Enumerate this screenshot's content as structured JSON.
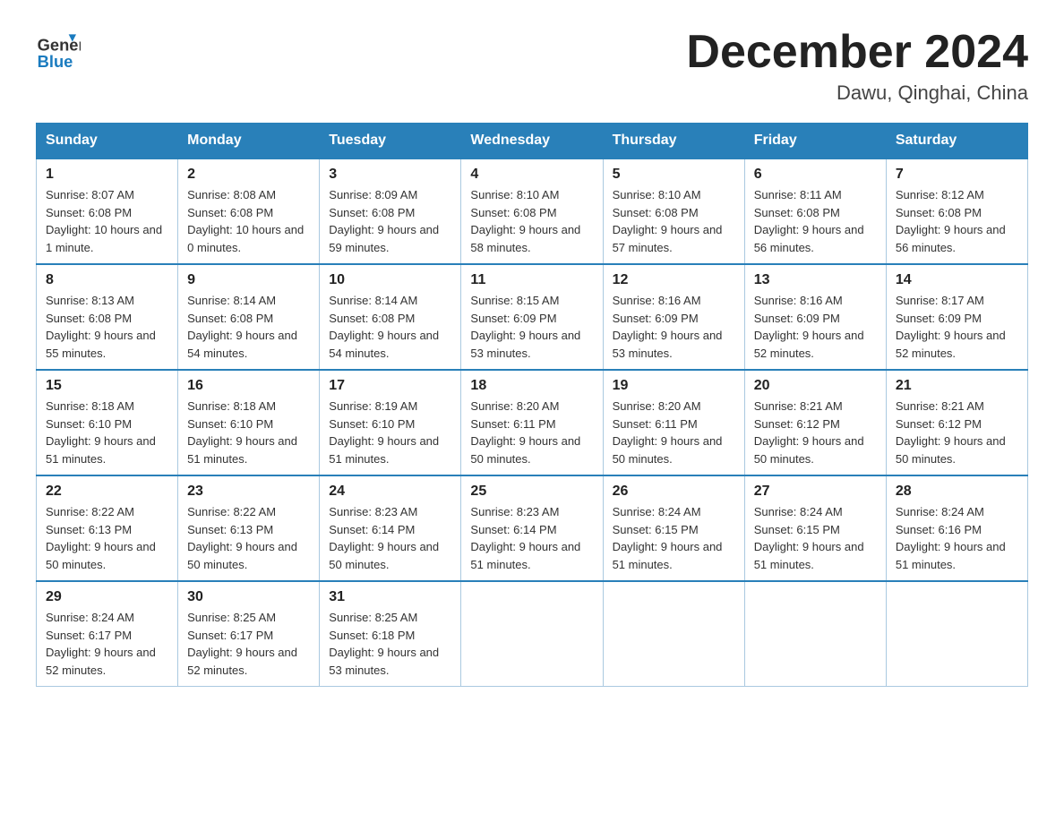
{
  "header": {
    "logo_general": "General",
    "logo_blue": "Blue",
    "title": "December 2024",
    "subtitle": "Dawu, Qinghai, China"
  },
  "calendar": {
    "days_of_week": [
      "Sunday",
      "Monday",
      "Tuesday",
      "Wednesday",
      "Thursday",
      "Friday",
      "Saturday"
    ],
    "weeks": [
      [
        {
          "day": "1",
          "sunrise": "8:07 AM",
          "sunset": "6:08 PM",
          "daylight": "10 hours and 1 minute."
        },
        {
          "day": "2",
          "sunrise": "8:08 AM",
          "sunset": "6:08 PM",
          "daylight": "10 hours and 0 minutes."
        },
        {
          "day": "3",
          "sunrise": "8:09 AM",
          "sunset": "6:08 PM",
          "daylight": "9 hours and 59 minutes."
        },
        {
          "day": "4",
          "sunrise": "8:10 AM",
          "sunset": "6:08 PM",
          "daylight": "9 hours and 58 minutes."
        },
        {
          "day": "5",
          "sunrise": "8:10 AM",
          "sunset": "6:08 PM",
          "daylight": "9 hours and 57 minutes."
        },
        {
          "day": "6",
          "sunrise": "8:11 AM",
          "sunset": "6:08 PM",
          "daylight": "9 hours and 56 minutes."
        },
        {
          "day": "7",
          "sunrise": "8:12 AM",
          "sunset": "6:08 PM",
          "daylight": "9 hours and 56 minutes."
        }
      ],
      [
        {
          "day": "8",
          "sunrise": "8:13 AM",
          "sunset": "6:08 PM",
          "daylight": "9 hours and 55 minutes."
        },
        {
          "day": "9",
          "sunrise": "8:14 AM",
          "sunset": "6:08 PM",
          "daylight": "9 hours and 54 minutes."
        },
        {
          "day": "10",
          "sunrise": "8:14 AM",
          "sunset": "6:08 PM",
          "daylight": "9 hours and 54 minutes."
        },
        {
          "day": "11",
          "sunrise": "8:15 AM",
          "sunset": "6:09 PM",
          "daylight": "9 hours and 53 minutes."
        },
        {
          "day": "12",
          "sunrise": "8:16 AM",
          "sunset": "6:09 PM",
          "daylight": "9 hours and 53 minutes."
        },
        {
          "day": "13",
          "sunrise": "8:16 AM",
          "sunset": "6:09 PM",
          "daylight": "9 hours and 52 minutes."
        },
        {
          "day": "14",
          "sunrise": "8:17 AM",
          "sunset": "6:09 PM",
          "daylight": "9 hours and 52 minutes."
        }
      ],
      [
        {
          "day": "15",
          "sunrise": "8:18 AM",
          "sunset": "6:10 PM",
          "daylight": "9 hours and 51 minutes."
        },
        {
          "day": "16",
          "sunrise": "8:18 AM",
          "sunset": "6:10 PM",
          "daylight": "9 hours and 51 minutes."
        },
        {
          "day": "17",
          "sunrise": "8:19 AM",
          "sunset": "6:10 PM",
          "daylight": "9 hours and 51 minutes."
        },
        {
          "day": "18",
          "sunrise": "8:20 AM",
          "sunset": "6:11 PM",
          "daylight": "9 hours and 50 minutes."
        },
        {
          "day": "19",
          "sunrise": "8:20 AM",
          "sunset": "6:11 PM",
          "daylight": "9 hours and 50 minutes."
        },
        {
          "day": "20",
          "sunrise": "8:21 AM",
          "sunset": "6:12 PM",
          "daylight": "9 hours and 50 minutes."
        },
        {
          "day": "21",
          "sunrise": "8:21 AM",
          "sunset": "6:12 PM",
          "daylight": "9 hours and 50 minutes."
        }
      ],
      [
        {
          "day": "22",
          "sunrise": "8:22 AM",
          "sunset": "6:13 PM",
          "daylight": "9 hours and 50 minutes."
        },
        {
          "day": "23",
          "sunrise": "8:22 AM",
          "sunset": "6:13 PM",
          "daylight": "9 hours and 50 minutes."
        },
        {
          "day": "24",
          "sunrise": "8:23 AM",
          "sunset": "6:14 PM",
          "daylight": "9 hours and 50 minutes."
        },
        {
          "day": "25",
          "sunrise": "8:23 AM",
          "sunset": "6:14 PM",
          "daylight": "9 hours and 51 minutes."
        },
        {
          "day": "26",
          "sunrise": "8:24 AM",
          "sunset": "6:15 PM",
          "daylight": "9 hours and 51 minutes."
        },
        {
          "day": "27",
          "sunrise": "8:24 AM",
          "sunset": "6:15 PM",
          "daylight": "9 hours and 51 minutes."
        },
        {
          "day": "28",
          "sunrise": "8:24 AM",
          "sunset": "6:16 PM",
          "daylight": "9 hours and 51 minutes."
        }
      ],
      [
        {
          "day": "29",
          "sunrise": "8:24 AM",
          "sunset": "6:17 PM",
          "daylight": "9 hours and 52 minutes."
        },
        {
          "day": "30",
          "sunrise": "8:25 AM",
          "sunset": "6:17 PM",
          "daylight": "9 hours and 52 minutes."
        },
        {
          "day": "31",
          "sunrise": "8:25 AM",
          "sunset": "6:18 PM",
          "daylight": "9 hours and 53 minutes."
        },
        null,
        null,
        null,
        null
      ]
    ]
  }
}
